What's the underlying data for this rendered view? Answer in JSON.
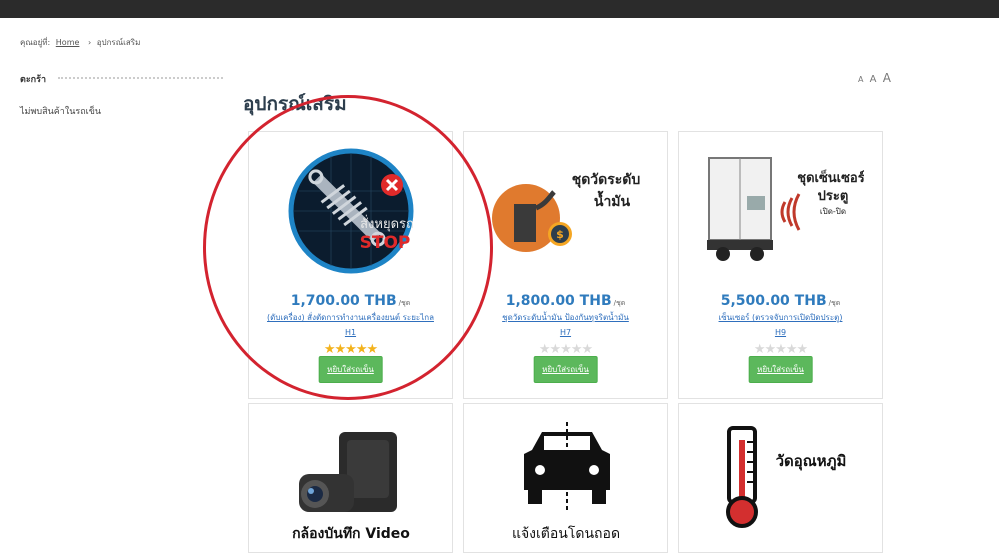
{
  "breadcrumb": {
    "prefix": "คุณอยู่ที่:",
    "home": "Home",
    "separator": "›",
    "current": "อุปกรณ์เสริม"
  },
  "sidebar": {
    "cart_title": "ตะกร้า",
    "cart_empty": "ไม่พบสินค้าในรถเข็น"
  },
  "font_size": {
    "small": "A",
    "medium": "A",
    "large": "A"
  },
  "page_title": "อุปกรณ์เสริม",
  "accent_colors": {
    "price": "#2f7bbd",
    "button": "#5cb85c",
    "highlight_circle": "#d3232f",
    "star": "#f3b21c"
  },
  "products": [
    {
      "image_text": [
        "สั่งหยุดรถ",
        "STOP"
      ],
      "price": "1,700.00 THB",
      "unit": "/ชุด",
      "name": "(ดับเครื่อง) สั่งตัดการทำงานเครื่องยนต์ ระยะไกล",
      "code": "H1",
      "rating": 5,
      "button": "หยิบใส่รถเข็น"
    },
    {
      "image_text": [
        "ชุดวัดระดับ",
        "น้ำมัน"
      ],
      "price": "1,800.00 THB",
      "unit": "/ชุด",
      "name": "ชุดวัดระดับน้ำมัน ป้องกันทุจริตน้ำมัน",
      "code": "H7",
      "rating": 0,
      "button": "หยิบใส่รถเข็น"
    },
    {
      "image_text": [
        "ชุดเซ็นเซอร์",
        "ประตู",
        "เปิด-ปิด"
      ],
      "price": "5,500.00 THB",
      "unit": "/ชุด",
      "name": "เซ็นเซอร์ (ตรวจจับการเปิดปิดประตู)",
      "code": "H9",
      "rating": 0,
      "button": "หยิบใส่รถเข็น"
    },
    {
      "image_text": [
        "กล้องบันทึก Video"
      ]
    },
    {
      "image_text": [
        "แจ้งเตือนโดนถอด"
      ]
    },
    {
      "image_text": [
        "วัดอุณหภูมิ"
      ]
    }
  ]
}
